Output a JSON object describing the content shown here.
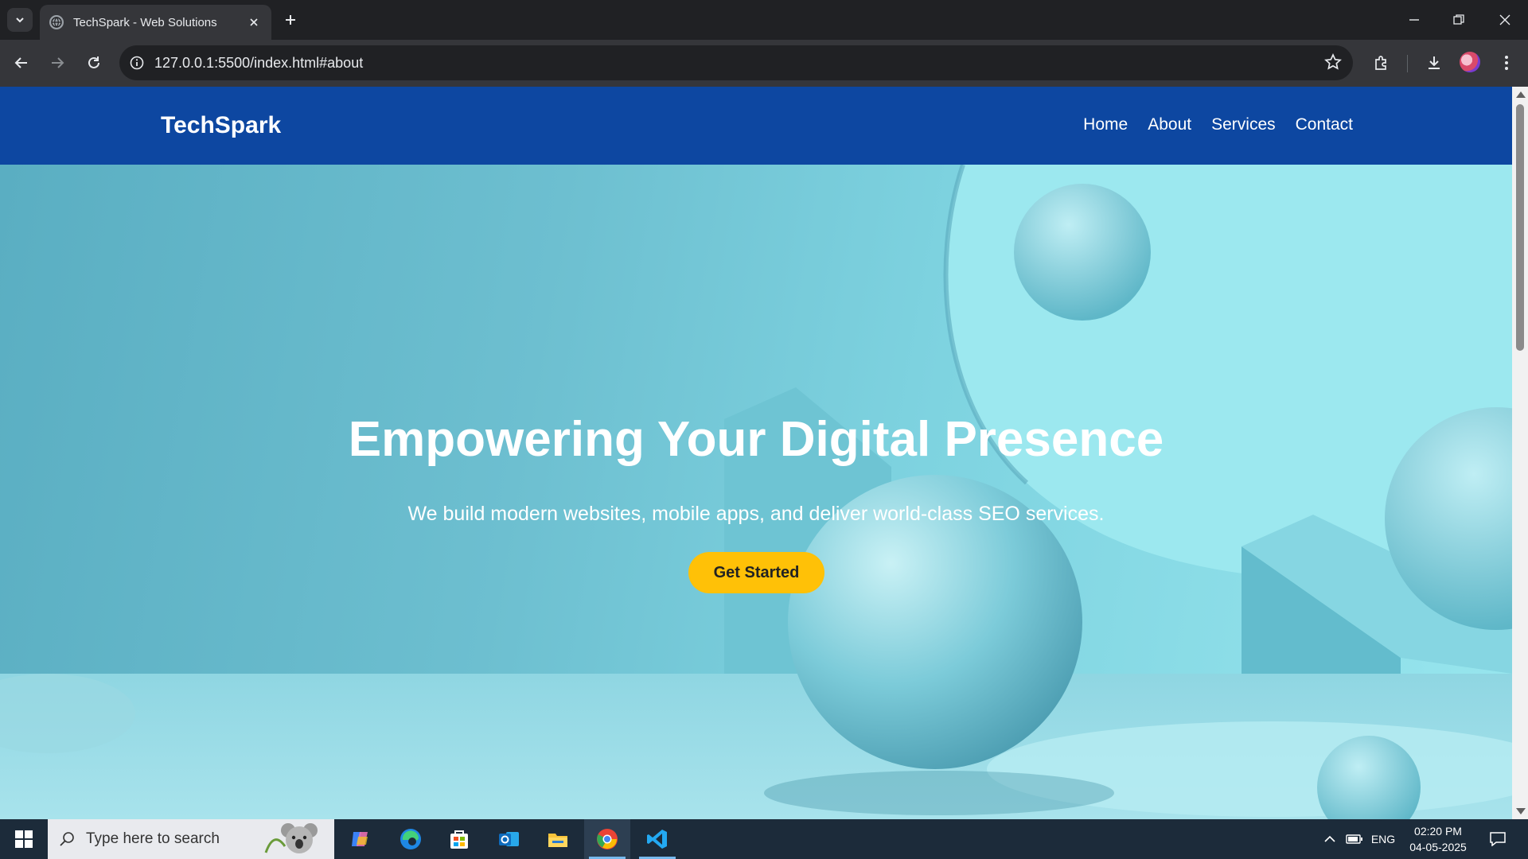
{
  "browser": {
    "tab_title": "TechSpark - Web Solutions",
    "url": "127.0.0.1:5500/index.html#about"
  },
  "site": {
    "brand": "TechSpark",
    "nav": [
      "Home",
      "About",
      "Services",
      "Contact"
    ],
    "colors": {
      "nav_bg": "#0d47a1",
      "cta_bg": "#ffc107"
    }
  },
  "hero": {
    "heading": "Empowering Your Digital Presence",
    "subheading": "We build modern websites, mobile apps, and deliver world-class SEO services.",
    "cta": "Get Started"
  },
  "taskbar": {
    "search_placeholder": "Type here to search",
    "apps": [
      "copilot-icon",
      "edge-icon",
      "store-icon",
      "outlook-icon",
      "file-explorer-icon",
      "chrome-icon",
      "vscode-icon"
    ],
    "language": "ENG",
    "time": "02:20 PM",
    "date": "04-05-2025"
  }
}
